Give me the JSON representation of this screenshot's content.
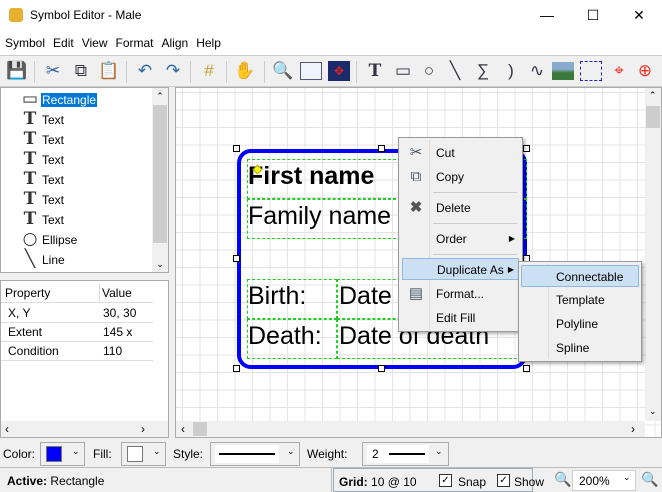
{
  "window": {
    "title": "Symbol Editor - Male",
    "icon": "app-icon",
    "controls": [
      "minimize",
      "maximize",
      "close"
    ]
  },
  "menubar": [
    "Symbol",
    "Edit",
    "View",
    "Format",
    "Align",
    "Help"
  ],
  "toolbar": [
    "save-icon",
    "cut-icon",
    "copy-icon",
    "paste-icon",
    "undo-icon",
    "redo-icon",
    "grid-icon",
    "pan-hand-icon",
    "zoom-icon",
    "select-rect-icon",
    "fit-icon",
    "text-tool-icon",
    "rectangle-tool-icon",
    "ellipse-tool-icon",
    "line-tool-icon",
    "sum-tool-icon",
    "arc-tool-icon",
    "curve-tool-icon",
    "image-tool-icon",
    "connector-tool-icon",
    "pin-tool-icon",
    "origin-tool-icon"
  ],
  "tree": {
    "items": [
      {
        "icon": "rectangle-icon",
        "label": "Rectangle",
        "selected": true
      },
      {
        "icon": "text-icon",
        "label": "Text"
      },
      {
        "icon": "text-icon",
        "label": "Text"
      },
      {
        "icon": "text-icon",
        "label": "Text"
      },
      {
        "icon": "text-icon",
        "label": "Text"
      },
      {
        "icon": "text-icon",
        "label": "Text"
      },
      {
        "icon": "text-icon",
        "label": "Text"
      },
      {
        "icon": "ellipse-icon",
        "label": "Ellipse"
      },
      {
        "icon": "line-icon",
        "label": "Line"
      }
    ]
  },
  "properties": {
    "headers": [
      "Property",
      "Value"
    ],
    "rows": [
      [
        "X, Y",
        "30, 30"
      ],
      [
        "Extent",
        "145 x 110"
      ],
      [
        "Condition",
        ""
      ]
    ]
  },
  "canvas": {
    "first_name": "First name",
    "family_name": "Family name",
    "birth_label": "Birth:",
    "birth_value": "Date of birth",
    "death_label": "Death:",
    "death_value": "Date of death",
    "shape_color": "#0000ff"
  },
  "context_menu": {
    "items": [
      "Cut",
      "Copy",
      "Delete",
      "Order",
      "Duplicate As",
      "Format...",
      "Edit Fill"
    ],
    "highlighted": "Duplicate As"
  },
  "submenu": {
    "items": [
      "Connectable",
      "Template",
      "Polyline",
      "Spline"
    ],
    "highlighted": "Connectable"
  },
  "bottombar": {
    "color_label": "Color:",
    "color_value": "#0000ff",
    "fill_label": "Fill:",
    "fill_value": "#ffffff",
    "style_label": "Style:",
    "weight_label": "Weight:",
    "weight_value": "2"
  },
  "status": {
    "active_label": "Active:",
    "active_value": "Rectangle",
    "grid_label": "Grid:",
    "grid_value": "10 @ 10",
    "snap_label": "Snap",
    "snap_checked": true,
    "show_label": "Show",
    "show_checked": true,
    "zoom": "200%"
  }
}
